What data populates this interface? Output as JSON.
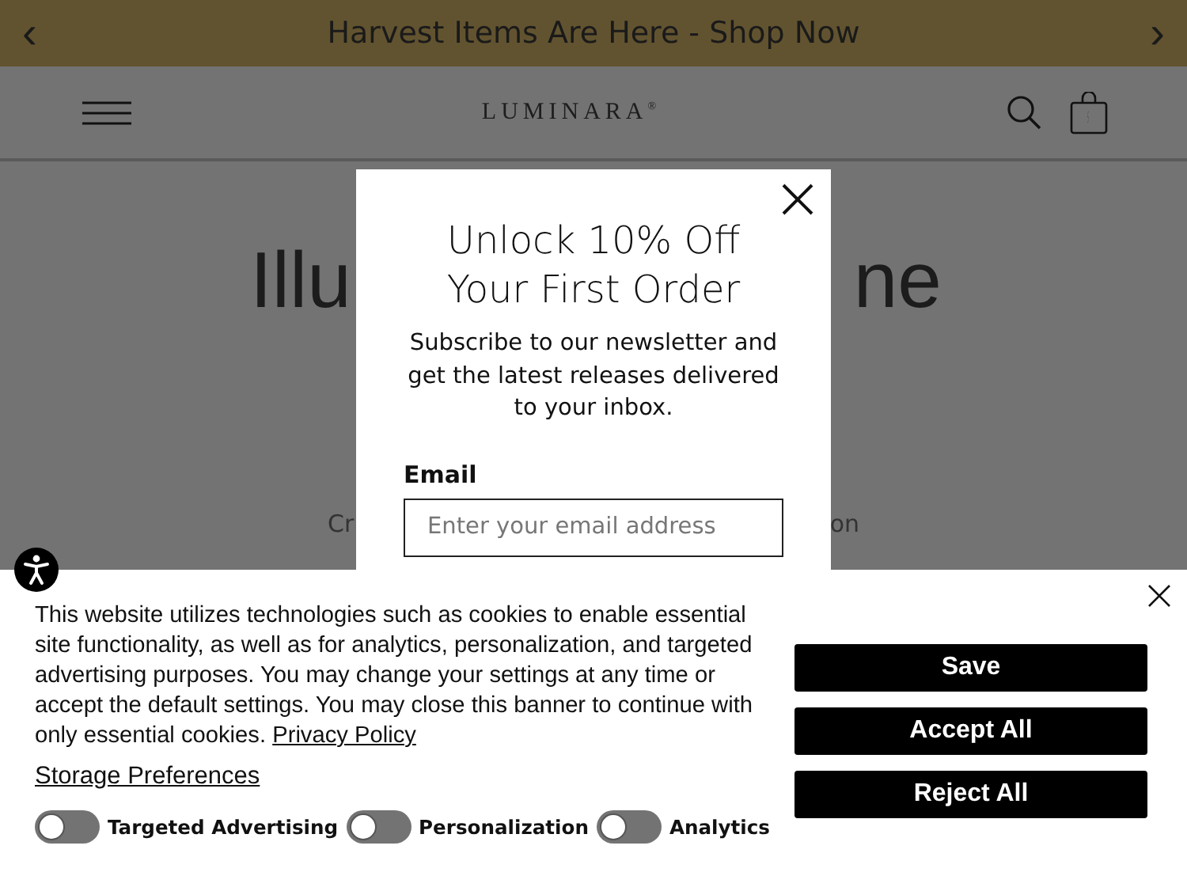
{
  "announcement": {
    "text": "Harvest Items Are Here - Shop Now",
    "prev": "‹",
    "next": "›"
  },
  "header": {
    "logo": "LUMINARA",
    "logo_mark": "®"
  },
  "hero": {
    "title_left": "Illu",
    "title_right": "ne",
    "subtitle_left": "Cr",
    "subtitle_right": "on"
  },
  "modal": {
    "title_lines": [
      "Unlock 10% Off",
      "Your First Order"
    ],
    "body": "Subscribe to our newsletter and get the latest releases delivered to your inbox.",
    "email_label": "Email",
    "email_placeholder": "Enter your email address"
  },
  "cookie_banner": {
    "text": "This website utilizes technologies such as cookies to enable essential site functionality, as well as for analytics, personalization, and targeted advertising purposes. You may change your settings at any time or accept the default settings. You may close this banner to continue with only essential cookies.",
    "privacy_link": "Privacy Policy",
    "preferences_link": "Storage Preferences",
    "toggles": [
      {
        "label": "Targeted Advertising",
        "on": false
      },
      {
        "label": "Personalization",
        "on": false
      },
      {
        "label": "Analytics",
        "on": false
      }
    ],
    "buttons": [
      "Save",
      "Accept All",
      "Reject All"
    ]
  }
}
